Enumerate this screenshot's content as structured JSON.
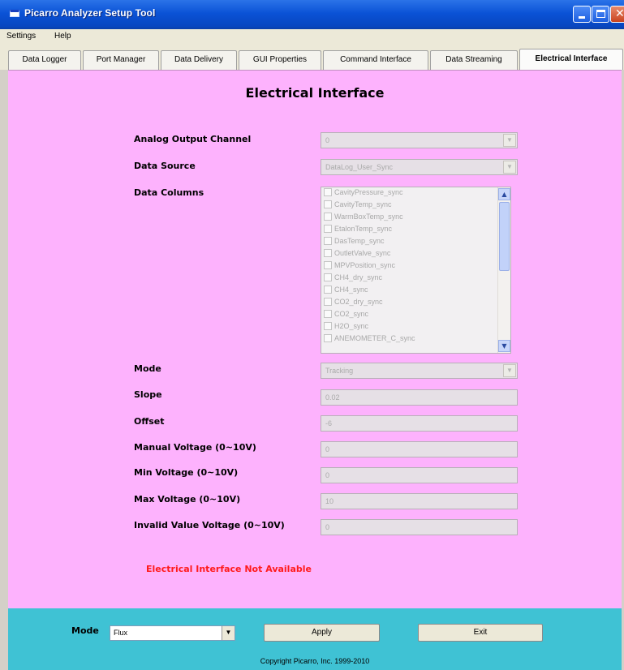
{
  "window": {
    "title": "Picarro Analyzer Setup Tool"
  },
  "menu": {
    "items": [
      "Settings",
      "Help"
    ]
  },
  "tabs": [
    {
      "label": "Data Logger",
      "active": false
    },
    {
      "label": "Port Manager",
      "active": false
    },
    {
      "label": "Data Delivery",
      "active": false
    },
    {
      "label": "GUI Properties",
      "active": false
    },
    {
      "label": "Command Interface",
      "active": false
    },
    {
      "label": "Data Streaming",
      "active": false
    },
    {
      "label": "Electrical Interface",
      "active": true
    }
  ],
  "panel": {
    "title": "Electrical Interface",
    "analog_output_channel": {
      "label": "Analog Output Channel",
      "value": "0"
    },
    "data_source": {
      "label": "Data Source",
      "value": "DataLog_User_Sync"
    },
    "data_columns": {
      "label": "Data Columns",
      "items": [
        "CavityPressure_sync",
        "CavityTemp_sync",
        "WarmBoxTemp_sync",
        "EtalonTemp_sync",
        "DasTemp_sync",
        "OutletValve_sync",
        "MPVPosition_sync",
        "CH4_dry_sync",
        "CH4_sync",
        "CO2_dry_sync",
        "CO2_sync",
        "H2O_sync",
        "ANEMOMETER_C_sync"
      ]
    },
    "mode": {
      "label": "Mode",
      "value": "Tracking"
    },
    "slope": {
      "label": "Slope",
      "value": "0.02"
    },
    "offset": {
      "label": "Offset",
      "value": "-6"
    },
    "manual_voltage": {
      "label": "Manual Voltage (0~10V)",
      "value": "0"
    },
    "min_voltage": {
      "label": "Min Voltage (0~10V)",
      "value": "0"
    },
    "max_voltage": {
      "label": "Max Voltage (0~10V)",
      "value": "10"
    },
    "invalid_voltage": {
      "label": "Invalid Value Voltage (0~10V)",
      "value": "0"
    },
    "warning": "Electrical Interface Not Available"
  },
  "bottom": {
    "mode_label": "Mode",
    "mode_value": "Flux",
    "apply_label": "Apply",
    "exit_label": "Exit",
    "copyright": "Copyright Picarro, Inc. 1999-2010"
  },
  "colors": {
    "panel_bg": "#fdb2fd",
    "bottom_bg": "#3fc2d4",
    "warning": "#ff1a1a",
    "titlebar": "#0a52d6"
  }
}
